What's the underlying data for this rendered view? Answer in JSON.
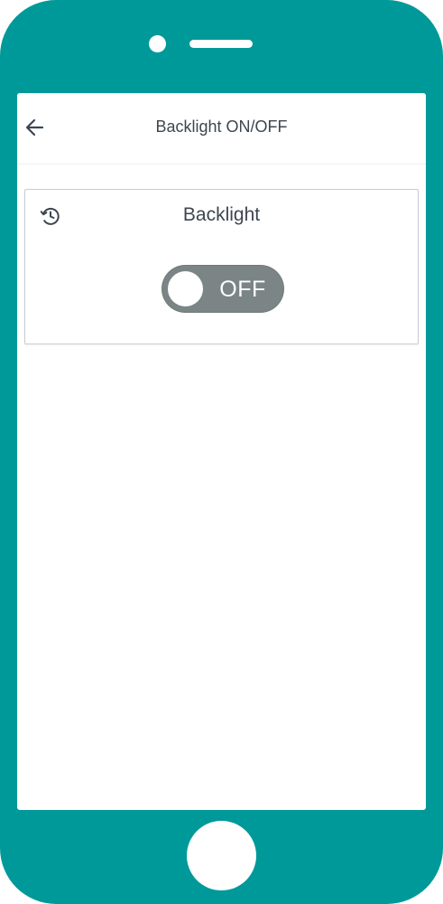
{
  "device": {
    "frame_color": "#00999a"
  },
  "appbar": {
    "title": "Backlight ON/OFF",
    "back_icon": "arrow-left-icon"
  },
  "card": {
    "title": "Backlight",
    "history_icon": "history-icon",
    "toggle": {
      "state": "OFF",
      "label": "OFF",
      "off_color": "#7b8586"
    }
  },
  "colors": {
    "text": "#3d4650",
    "card_border": "#c9cdd0"
  }
}
